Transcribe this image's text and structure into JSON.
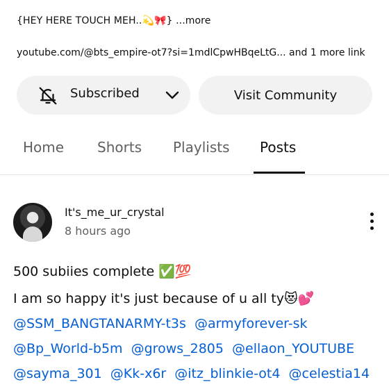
{
  "channel": {
    "description": "{HEY HERE TOUCH MEH..💫🎀}",
    "more_label": "...more",
    "link_text": "youtube.com/@bts_empire-ot7?si=1mdlCpwHBqeLtG...",
    "more_links": "and 1 more link"
  },
  "actions": {
    "subscribed_label": "Subscribed",
    "visit_label": "Visit Community"
  },
  "tabs": [
    {
      "label": "Home"
    },
    {
      "label": "Shorts"
    },
    {
      "label": "Playlists"
    },
    {
      "label": "Posts"
    }
  ],
  "post": {
    "author": "It's_me_ur_crystal",
    "time": "8 hours ago",
    "line1": "500 subiies complete ✅💯",
    "line2": "I am so happy it's just because of u all ty😻💕",
    "mentions": [
      "@SSM_BANGTANARMY-t3s",
      "@armyforever-sk",
      "@Bp_World-b5m",
      "@grows_2805",
      "@ellaon_YOUTUBE",
      "@sayma_301",
      "@Kk-x6r",
      "@itz_blinkie-ot4",
      "@celestia14"
    ]
  },
  "colors": {
    "link": "#065fd4",
    "chip_bg": "#f2f2f2",
    "secondary_text": "#606060"
  }
}
